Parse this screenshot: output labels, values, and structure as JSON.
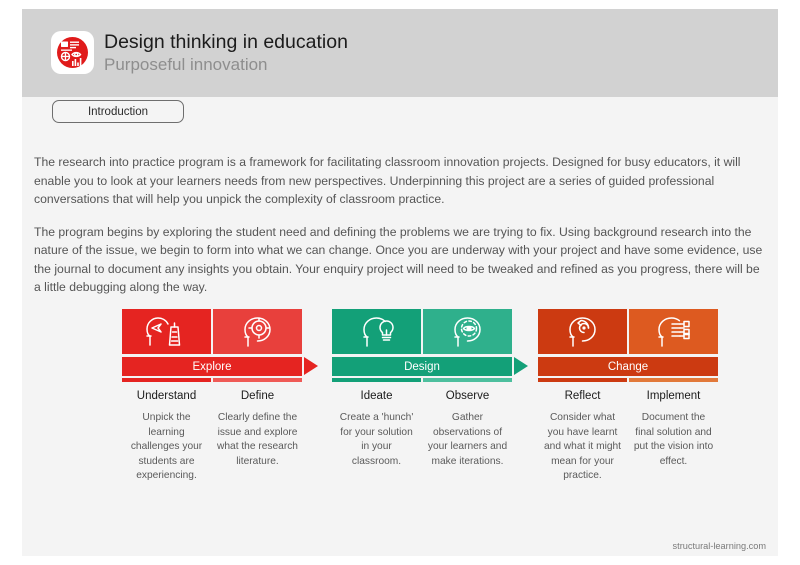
{
  "header": {
    "title": "Design thinking in education",
    "subtitle": "Purposeful innovation",
    "logo_icon": "structural-learning-logo-icon",
    "logo_color": "#e01b1b"
  },
  "tab": {
    "label": "Introduction"
  },
  "body": {
    "paragraphs": [
      "The research into practice program is a framework for facilitating classroom innovation projects. Designed for busy educators, it will enable you to look at your learners needs from new perspectives. Underpinning this project are a series of guided professional conversations that will help you unpick the complexity of classroom practice.",
      "The program begins by exploring the student need and defining the problems we are trying to fix. Using background research into the nature of the issue, we begin to form into what we can change. Once you are underway with your project and have some evidence, use the journal to document any insights you obtain. Your enquiry project will need to be tweaked and refined as you progress, there will be a little debugging along the way."
    ]
  },
  "diagram": {
    "stages": [
      {
        "name": "Explore",
        "banner_color": "#e52421",
        "arrow_color": "#e52421",
        "has_arrow": true,
        "steps": [
          {
            "label": "Understand",
            "description": "Unpick the learning challenges your students are experiencing.",
            "icon": "head-lighthouse-icon",
            "tile_color": "#e52421",
            "underline_color": "#e52421"
          },
          {
            "label": "Define",
            "description": "Clearly define the issue and explore what the research literature.",
            "icon": "head-target-icon",
            "tile_color": "#e8403c",
            "underline_color": "#ef5a56"
          }
        ]
      },
      {
        "name": "Design",
        "banner_color": "#13a078",
        "arrow_color": "#13a078",
        "has_arrow": true,
        "steps": [
          {
            "label": "Ideate",
            "description": "Create a 'hunch' for your solution in your classroom.",
            "icon": "head-lightbulb-icon",
            "tile_color": "#13a078",
            "underline_color": "#13a078"
          },
          {
            "label": "Observe",
            "description": "Gather observations of your learners and make iterations.",
            "icon": "head-eye-icon",
            "tile_color": "#2fb08c",
            "underline_color": "#4dbf9e"
          }
        ]
      },
      {
        "name": "Change",
        "banner_color": "#cc3a11",
        "arrow_color": "#cc3a11",
        "has_arrow": false,
        "steps": [
          {
            "label": "Reflect",
            "description": "Consider what you have learnt and what it might mean for your practice.",
            "icon": "head-spiral-icon",
            "tile_color": "#cc3a11",
            "underline_color": "#cc3a11"
          },
          {
            "label": "Implement",
            "description": "Document the final solution and put the vision into effect.",
            "icon": "head-checklist-icon",
            "tile_color": "#dd5a20",
            "underline_color": "#e2793a"
          }
        ]
      }
    ]
  },
  "footer": {
    "site": "structural-learning.com"
  }
}
